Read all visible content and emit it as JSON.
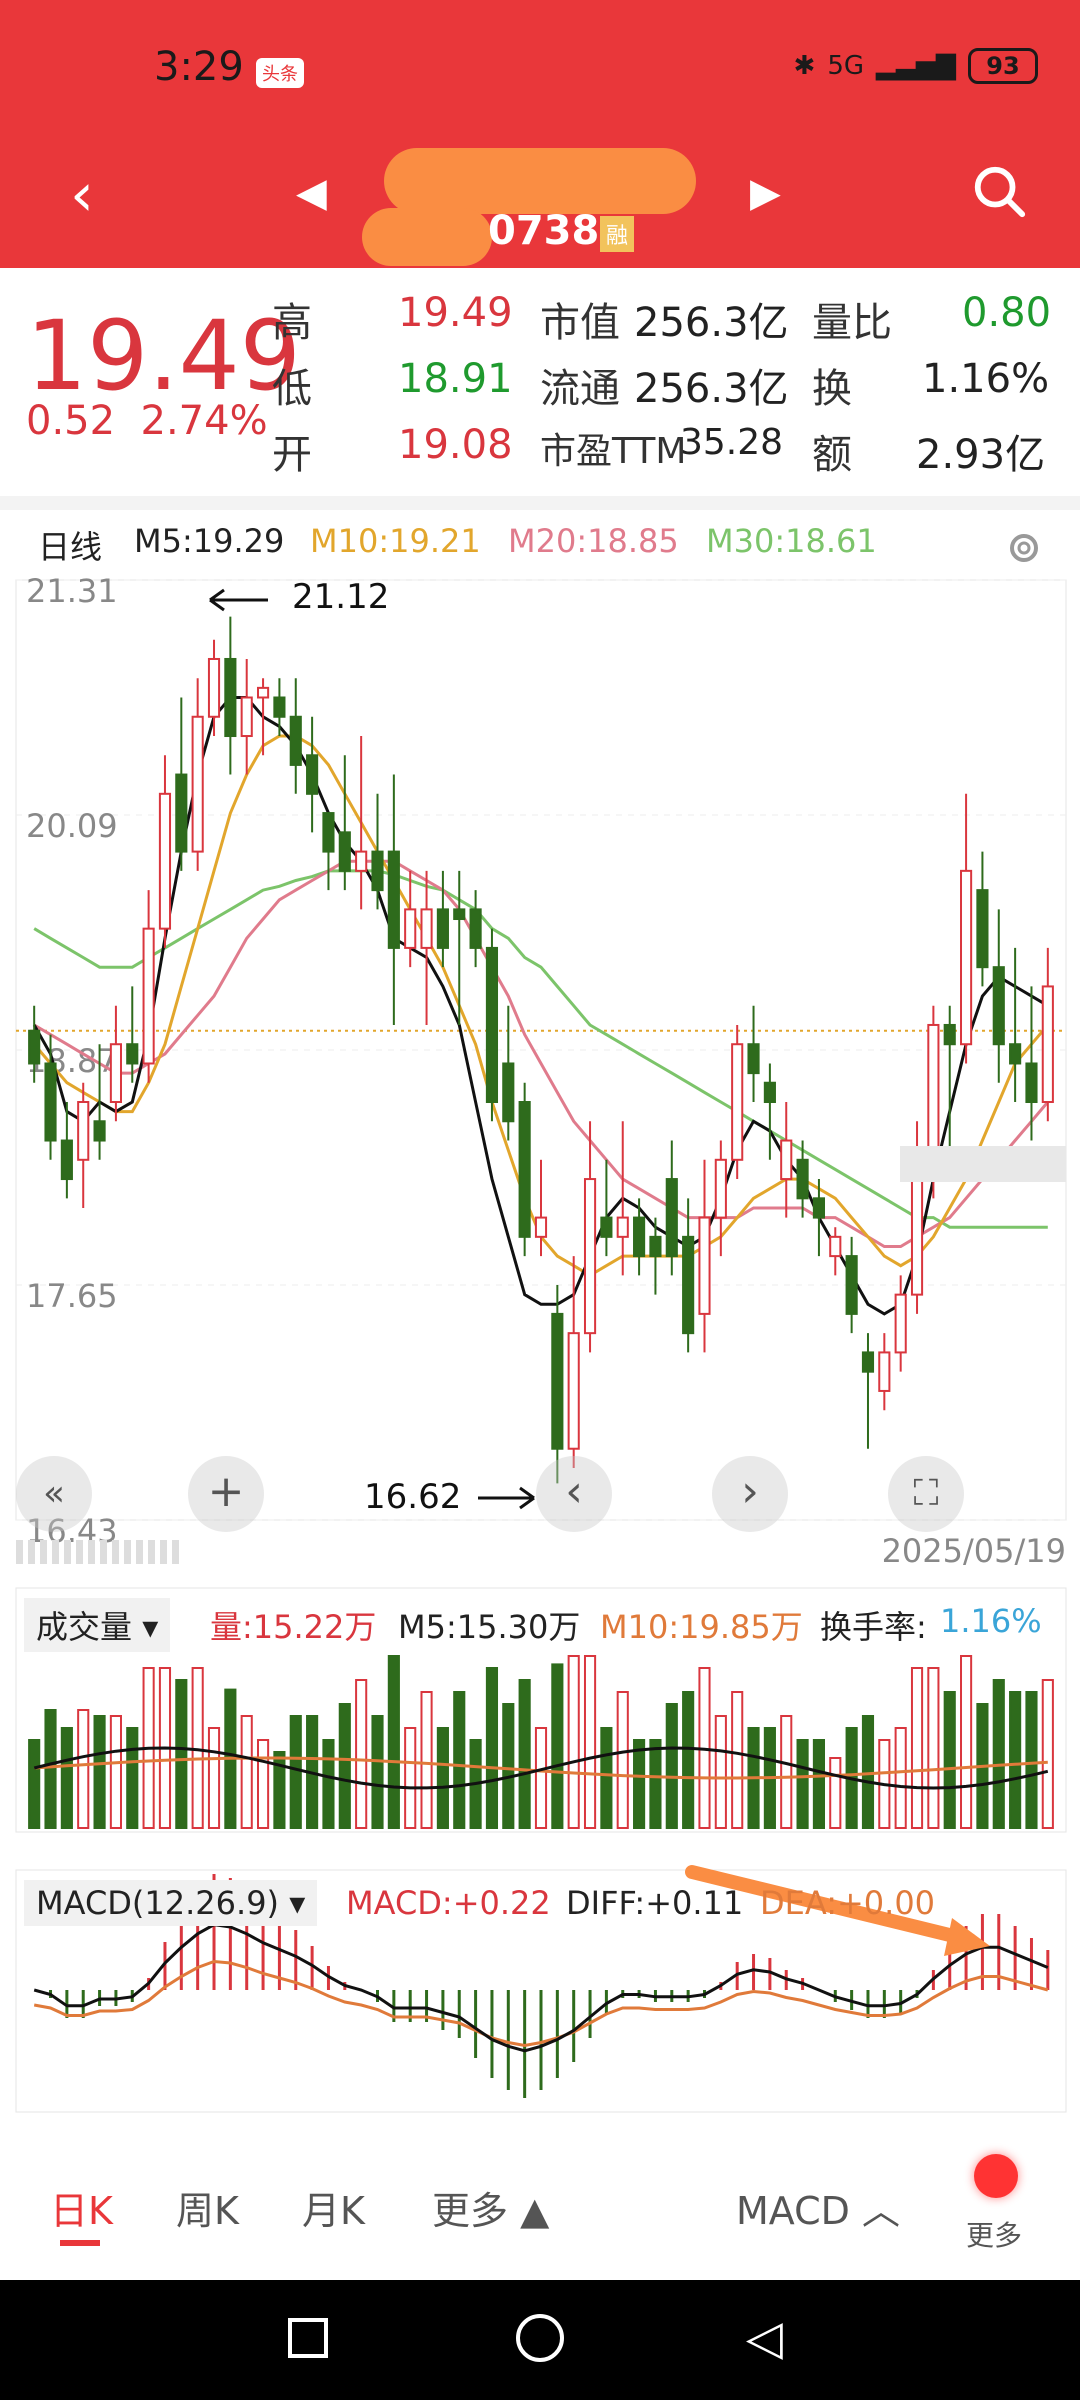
{
  "status": {
    "time": "3:29",
    "badge": "头条",
    "signal": "5G",
    "battery": "93"
  },
  "header": {
    "code_suffix": "0738",
    "margin_badge": "融"
  },
  "quote": {
    "price": "19.49",
    "change": "0.52",
    "change_pct": "2.74%",
    "rows": [
      {
        "l1": "高",
        "v1": "19.49",
        "l2": "市值",
        "v2": "256.3亿",
        "l3": "量比",
        "v3": "0.80"
      },
      {
        "l1": "低",
        "v1": "18.91",
        "l2": "流通",
        "v2": "256.3亿",
        "l3": "换",
        "v3": "1.16%"
      },
      {
        "l1": "开",
        "v1": "19.08",
        "l2": "市盈TTM",
        "v2": "35.28",
        "l3": "额",
        "v3": "2.93亿"
      }
    ]
  },
  "ma": {
    "period": "日线",
    "m5": "M5:19.29",
    "m10": "M10:19.21",
    "m20": "M20:18.85",
    "m30": "M30:18.61"
  },
  "kline": {
    "y_labels": [
      "21.31",
      "20.09",
      "18.87",
      "17.65",
      "16.43"
    ],
    "high_annot": "21.12",
    "low_annot": "16.62",
    "date": "2025/05/19",
    "ylim": [
      16.43,
      21.31
    ],
    "ref_price": 18.97,
    "candles": [
      [
        18.97,
        18.8,
        19.1,
        18.7
      ],
      [
        18.8,
        18.4,
        18.95,
        18.3
      ],
      [
        18.4,
        18.2,
        18.6,
        18.1
      ],
      [
        18.3,
        18.6,
        18.7,
        18.05
      ],
      [
        18.5,
        18.4,
        18.9,
        18.3
      ],
      [
        18.6,
        18.9,
        19.1,
        18.5
      ],
      [
        18.9,
        18.8,
        19.2,
        18.7
      ],
      [
        18.8,
        19.5,
        19.7,
        18.7
      ],
      [
        19.5,
        20.2,
        20.4,
        19.4
      ],
      [
        20.3,
        19.9,
        20.7,
        19.8
      ],
      [
        19.9,
        20.6,
        20.8,
        19.8
      ],
      [
        20.6,
        20.9,
        21.0,
        20.5
      ],
      [
        20.9,
        20.5,
        21.12,
        20.3
      ],
      [
        20.5,
        20.7,
        20.9,
        20.3
      ],
      [
        20.7,
        20.75,
        20.8,
        20.4
      ],
      [
        20.7,
        20.6,
        20.8,
        20.5
      ],
      [
        20.6,
        20.35,
        20.8,
        20.2
      ],
      [
        20.4,
        20.2,
        20.6,
        20.0
      ],
      [
        20.1,
        19.9,
        20.1,
        19.7
      ],
      [
        20.0,
        19.8,
        20.4,
        19.7
      ],
      [
        19.8,
        19.9,
        20.5,
        19.6
      ],
      [
        19.9,
        19.7,
        20.2,
        19.6
      ],
      [
        19.9,
        19.4,
        20.3,
        19.0
      ],
      [
        19.4,
        19.6,
        19.8,
        19.3
      ],
      [
        19.4,
        19.6,
        19.8,
        19.0
      ],
      [
        19.6,
        19.4,
        19.8,
        19.3
      ],
      [
        19.6,
        19.55,
        19.8,
        19.0
      ],
      [
        19.6,
        19.4,
        19.7,
        19.3
      ],
      [
        19.4,
        18.6,
        19.5,
        18.5
      ],
      [
        18.8,
        18.5,
        19.1,
        18.4
      ],
      [
        18.6,
        17.9,
        18.7,
        17.8
      ],
      [
        17.9,
        18.0,
        18.3,
        17.8
      ],
      [
        17.5,
        16.8,
        17.65,
        16.62
      ],
      [
        16.8,
        17.4,
        17.8,
        16.7
      ],
      [
        17.4,
        18.2,
        18.5,
        17.3
      ],
      [
        18.0,
        17.9,
        18.3,
        17.8
      ],
      [
        17.9,
        18.0,
        18.5,
        17.7
      ],
      [
        18.0,
        17.8,
        18.1,
        17.7
      ],
      [
        17.9,
        17.8,
        18.0,
        17.6
      ],
      [
        18.2,
        17.8,
        18.4,
        17.7
      ],
      [
        17.9,
        17.4,
        18.1,
        17.3
      ],
      [
        17.5,
        18.0,
        18.3,
        17.3
      ],
      [
        18.0,
        18.3,
        18.4,
        17.8
      ],
      [
        18.3,
        18.9,
        19.0,
        18.2
      ],
      [
        18.9,
        18.75,
        19.1,
        18.6
      ],
      [
        18.7,
        18.6,
        18.8,
        18.3
      ],
      [
        18.2,
        18.4,
        18.6,
        18.0
      ],
      [
        18.3,
        18.1,
        18.4,
        18.0
      ],
      [
        18.1,
        18.0,
        18.2,
        17.8
      ],
      [
        17.8,
        17.9,
        17.95,
        17.7
      ],
      [
        17.8,
        17.5,
        17.9,
        17.4
      ],
      [
        17.3,
        17.2,
        17.4,
        16.8
      ],
      [
        17.1,
        17.3,
        17.4,
        17.0
      ],
      [
        17.3,
        17.6,
        17.7,
        17.2
      ],
      [
        17.6,
        18.2,
        18.5,
        17.5
      ],
      [
        18.2,
        19.0,
        19.1,
        18.1
      ],
      [
        19.0,
        18.9,
        19.1,
        18.3
      ],
      [
        18.9,
        19.8,
        20.2,
        18.8
      ],
      [
        19.7,
        19.3,
        19.9,
        19.2
      ],
      [
        19.3,
        18.9,
        19.6,
        18.7
      ],
      [
        18.9,
        18.8,
        19.4,
        18.6
      ],
      [
        18.8,
        18.6,
        19.2,
        18.4
      ],
      [
        18.6,
        19.2,
        19.4,
        18.5
      ]
    ],
    "ma_lines": {
      "m5": [
        19.0,
        18.85,
        18.55,
        18.5,
        18.6,
        18.55,
        18.6,
        18.95,
        19.45,
        19.9,
        20.3,
        20.6,
        20.7,
        20.7,
        20.6,
        20.55,
        20.45,
        20.3,
        20.1,
        19.95,
        19.85,
        19.7,
        19.45,
        19.4,
        19.35,
        19.2,
        19.0,
        18.6,
        18.2,
        17.9,
        17.6,
        17.55,
        17.55,
        17.6,
        17.8,
        18.0,
        18.1,
        18.05,
        17.95,
        17.9,
        17.85,
        17.9,
        18.1,
        18.35,
        18.5,
        18.45,
        18.3,
        18.2,
        18.0,
        17.85,
        17.7,
        17.55,
        17.5,
        17.55,
        17.8,
        18.2,
        18.55,
        18.9,
        19.15,
        19.25,
        19.2,
        19.15,
        19.1
      ],
      "m10": [
        18.9,
        18.8,
        18.7,
        18.65,
        18.6,
        18.55,
        18.55,
        18.7,
        18.9,
        19.2,
        19.5,
        19.8,
        20.1,
        20.3,
        20.45,
        20.5,
        20.5,
        20.45,
        20.35,
        20.2,
        20.05,
        19.9,
        19.75,
        19.6,
        19.45,
        19.3,
        19.1,
        18.9,
        18.6,
        18.35,
        18.1,
        17.9,
        17.8,
        17.75,
        17.7,
        17.75,
        17.8,
        17.8,
        17.8,
        17.8,
        17.8,
        17.85,
        17.9,
        18.0,
        18.1,
        18.15,
        18.2,
        18.2,
        18.15,
        18.1,
        18.0,
        17.9,
        17.8,
        17.75,
        17.8,
        17.9,
        18.05,
        18.2,
        18.4,
        18.6,
        18.8,
        18.9,
        19.0
      ],
      "m20": [
        19.0,
        18.95,
        18.9,
        18.85,
        18.8,
        18.75,
        18.75,
        18.8,
        18.85,
        18.95,
        19.05,
        19.15,
        19.3,
        19.45,
        19.55,
        19.65,
        19.7,
        19.75,
        19.8,
        19.85,
        19.85,
        19.85,
        19.85,
        19.8,
        19.75,
        19.7,
        19.6,
        19.45,
        19.3,
        19.15,
        18.95,
        18.8,
        18.65,
        18.5,
        18.4,
        18.3,
        18.2,
        18.15,
        18.1,
        18.05,
        18.0,
        18.0,
        18.0,
        18.0,
        18.05,
        18.05,
        18.05,
        18.05,
        18.0,
        18.0,
        17.95,
        17.9,
        17.85,
        17.85,
        17.9,
        17.95,
        18.0,
        18.1,
        18.2,
        18.3,
        18.4,
        18.5,
        18.6
      ],
      "m30": [
        19.5,
        19.45,
        19.4,
        19.35,
        19.3,
        19.3,
        19.3,
        19.35,
        19.4,
        19.45,
        19.5,
        19.55,
        19.6,
        19.65,
        19.7,
        19.72,
        19.75,
        19.77,
        19.8,
        19.8,
        19.8,
        19.8,
        19.78,
        19.75,
        19.72,
        19.7,
        19.65,
        19.6,
        19.5,
        19.45,
        19.35,
        19.3,
        19.2,
        19.1,
        19.0,
        18.95,
        18.9,
        18.85,
        18.8,
        18.75,
        18.7,
        18.65,
        18.6,
        18.55,
        18.5,
        18.45,
        18.4,
        18.35,
        18.3,
        18.25,
        18.2,
        18.15,
        18.1,
        18.05,
        18.0,
        18.0,
        17.95,
        17.95,
        17.95,
        17.95,
        17.95,
        17.95,
        17.95
      ]
    }
  },
  "volume": {
    "selector": "成交量",
    "vol": "量:15.22万",
    "m5": "M5:15.30万",
    "m10": "M10:19.85万",
    "turnover_label": "换手率:",
    "turnover": "1.16%"
  },
  "macd": {
    "selector": "MACD(12.26.9)",
    "macd": "MACD:+0.22",
    "diff": "DIFF:+0.11",
    "dea": "DEA:+0.00"
  },
  "tabs": {
    "day": "日K",
    "week": "周K",
    "month": "月K",
    "more": "更多",
    "indicator": "MACD",
    "more2": "更多"
  },
  "colors": {
    "up": "#d9363e",
    "down": "#2e6b1c",
    "m5": "#111111",
    "m10": "#e2a62c",
    "m20": "#e07b8c",
    "m30": "#7cc46a",
    "header": "#e9373a"
  }
}
